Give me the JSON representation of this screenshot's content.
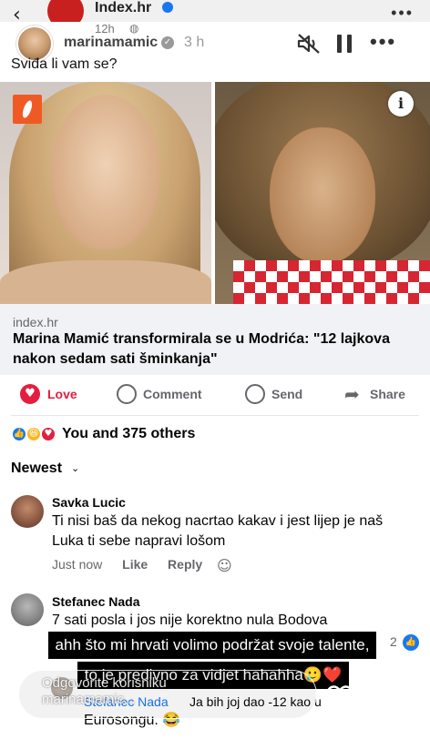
{
  "fb_header": {
    "source_name": "Index.hr",
    "time": "12h",
    "globe": "◍",
    "back": "‹",
    "more": "•••"
  },
  "story": {
    "username": "marinamamic",
    "verified_mark": "✓",
    "time": "3 h",
    "more": "•••"
  },
  "post": {
    "text": "Sviđa li vam se?",
    "info_label": "i",
    "link_domain": "index.hr",
    "link_title": "Marina Mamić transformirala se u Modrića: \"12 lajkova nakon sedam sati šminkanja\""
  },
  "actions": {
    "love": "Love",
    "comment": "Comment",
    "send": "Send",
    "share": "Share",
    "love_glyph": "♥",
    "share_glyph": "➦"
  },
  "reactions": {
    "summary": "You and 375 others",
    "like_glyph": "👍",
    "haha_glyph": "😆",
    "love_glyph": "♥"
  },
  "sort": {
    "label": "Newest",
    "chevron": "⌄"
  },
  "comments": [
    {
      "name": "Savka Lucic",
      "text": "Ti nisi baš da nekog nacrtao kakav i jest lijep je naš Luka ti sebe napravi lošom",
      "time": "Just now",
      "like": "Like",
      "reply": "Reply",
      "react_glyph": "☺"
    },
    {
      "name": "Stefanec Nada",
      "text": "7 sati posla i jos nije korektno nula Bodova",
      "reaction_count": "2",
      "reaction_glyph": "👍"
    },
    {
      "name": "Stefanec Nada",
      "text": "Ja bih joj dao -12 kao u",
      "text2": "Eurosongu. 😂"
    }
  ],
  "story_caption": {
    "line1": "ahh što mi hrvati volimo podržat svoje talente,",
    "line2": "to je predivno za vidjet hahahha🥲❤️"
  },
  "reply_bar": {
    "placeholder": "Odgovorite korisniku marinamamic..."
  },
  "colors": {
    "love_red": "#e41e3f",
    "fb_blue": "#1877f2",
    "brand_orange": "#ef5a24"
  }
}
